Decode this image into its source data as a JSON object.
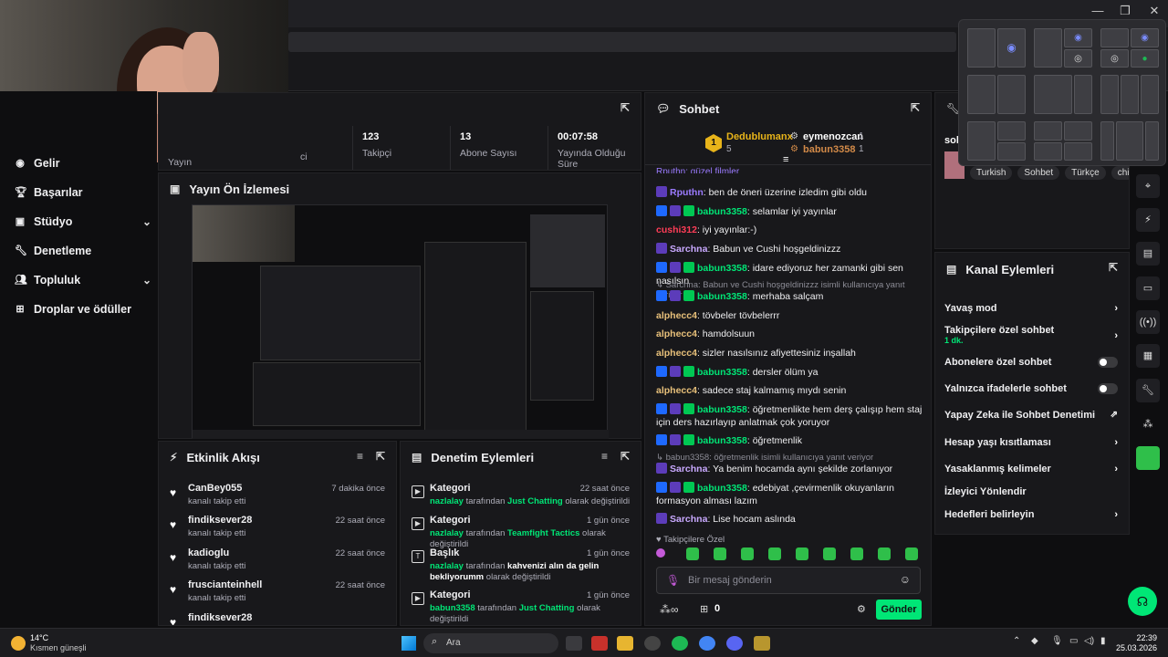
{
  "window": {
    "minimize": "—",
    "maximize": "❐",
    "close": "✕"
  },
  "stats": {
    "followers_value": "123",
    "followers_label": "Takipçi",
    "subs_value": "13",
    "subs_label": "Abone Sayısı",
    "uptime_value": "00:07:58",
    "uptime_label": "Yayında Olduğu Süre",
    "partial_label_1": "Yayın",
    "partial_label_2": "ci"
  },
  "sidebar": {
    "items": [
      {
        "label": "Gelir"
      },
      {
        "label": "Başarılar"
      },
      {
        "label": "Stüdyo"
      },
      {
        "label": "Denetleme"
      },
      {
        "label": "Topluluk"
      },
      {
        "label": "Droplar ve ödüller"
      }
    ]
  },
  "preview": {
    "title": "Yayın Ön İzlemesi"
  },
  "activity": {
    "title": "Etkinlik Akışı",
    "items": [
      {
        "name": "CanBey055",
        "sub": "kanalı takip etti",
        "time": "7 dakika önce"
      },
      {
        "name": "findiksever28",
        "sub": "kanalı takip etti",
        "time": "22 saat önce"
      },
      {
        "name": "kadioglu",
        "sub": "kanalı takip etti",
        "time": "22 saat önce"
      },
      {
        "name": "fruscianteinhell",
        "sub": "kanalı takip etti",
        "time": "22 saat önce"
      },
      {
        "name": "findiksever28",
        "sub": "",
        "time": ""
      }
    ]
  },
  "modlog": {
    "title": "Denetim Eylemleri",
    "items": [
      {
        "title": "Kategori",
        "user": "nazlalay",
        "mid": "tarafından",
        "value": "Just Chatting",
        "end": "olarak değiştirildi",
        "time": "22 saat önce"
      },
      {
        "title": "Kategori",
        "user": "nazlalay",
        "mid": "tarafından",
        "value": "Teamfight Tactics",
        "end": "olarak değiştirildi",
        "time": "1 gün önce"
      },
      {
        "title": "Başlık",
        "user": "nazlalay",
        "mid": "tarafından",
        "value": "kahvenizi alın da gelin bekliyorumm",
        "end": "olarak değiştirildi",
        "time": "1 gün önce"
      },
      {
        "title": "Kategori",
        "user": "babun3358",
        "mid": "tarafından",
        "value": "Just Chatting",
        "end": "olarak değiştirildi",
        "time": "1 gün önce"
      }
    ]
  },
  "chat": {
    "title": "Sohbet",
    "leader1": "Dedublumanx",
    "leader1_count": "5",
    "leader1_rank": "1",
    "leader2": "eymenozcan",
    "leader2_count": "1",
    "leader3": "babun3358",
    "leader3_count": "1",
    "partial_top": "Rputhn: güzel filmler",
    "messages": [
      {
        "user": "Rputhn",
        "color": "#9b7bff",
        "text": "ben de öneri üzerine izledim gibi oldu",
        "badges": [
          "star"
        ]
      },
      {
        "user": "babun3358",
        "color": "#00e676",
        "text": "selamlar iyi yayınlar",
        "badges": [
          "blue",
          "star",
          "green"
        ]
      },
      {
        "user": "cushi312",
        "color": "#ff3d57",
        "text": "iyi yayınlar:-)",
        "badges": []
      },
      {
        "user": "Sarchna",
        "color": "#c9a9ff",
        "text": "Babun ve Cushi hoşgeldinizzz",
        "badges": [
          "star"
        ]
      },
      {
        "user": "babun3358",
        "color": "#00e676",
        "text": "idare ediyoruz her zamanki gibi sen nasılsın",
        "badges": [
          "blue",
          "star",
          "green"
        ]
      }
    ],
    "reply1": "↳ Sarchna: Babun ve Cushi hoşgeldinizzz isimli kullanıcıya yanıt veriyor",
    "messages2": [
      {
        "user": "babun3358",
        "color": "#00e676",
        "text": "merhaba salçam",
        "badges": [
          "blue",
          "star",
          "green"
        ]
      },
      {
        "user": "alphecc4",
        "color": "#e8c07a",
        "text": "tövbeler tövbelerrr",
        "badges": []
      },
      {
        "user": "alphecc4",
        "color": "#e8c07a",
        "text": "hamdolsuun",
        "badges": []
      },
      {
        "user": "alphecc4",
        "color": "#e8c07a",
        "text": "sizler nasılsınız afiyettesiniz inşallah",
        "badges": []
      },
      {
        "user": "babun3358",
        "color": "#00e676",
        "text": "dersler ölüm ya",
        "badges": [
          "blue",
          "star",
          "green"
        ]
      },
      {
        "user": "alphecc4",
        "color": "#e8c07a",
        "text": "sadece staj kalmamış mıydı senin",
        "badges": []
      },
      {
        "user": "babun3358",
        "color": "#00e676",
        "text": "öğretmenlikte hem derş çalışıp hem staj için ders hazırlayıp anlatmak çok yoruyor",
        "badges": [
          "blue",
          "star",
          "green"
        ]
      },
      {
        "user": "babun3358",
        "color": "#00e676",
        "text": "öğretmenlik",
        "badges": [
          "blue",
          "star",
          "green"
        ]
      }
    ],
    "reply2": "↳ babun3358: öğretmenlik isimli kullanıcıya yanıt veriyor",
    "messages3": [
      {
        "user": "Sarchna",
        "color": "#c9a9ff",
        "text": "Ya benim hocamda aynı şekilde zorlanıyor",
        "badges": [
          "star"
        ]
      },
      {
        "user": "babun3358",
        "color": "#00e676",
        "text": "edebiyat ,çevirmenlik okuyanların formasyon alması lazım",
        "badges": [
          "blue",
          "star",
          "green"
        ]
      },
      {
        "user": "Sarchna",
        "color": "#c9a9ff",
        "text": "Lise hocam aslında",
        "badges": [
          "star"
        ]
      }
    ],
    "followers_only": "♥ Takipçilere Özel",
    "input_placeholder": "Bir mesaj gönderin",
    "points": "0",
    "send_label": "Gönder"
  },
  "about": {
    "partial_title": "soh",
    "tags": [
      "Turkish",
      "Sohbet",
      "Türkçe",
      "chi"
    ]
  },
  "channel_actions": {
    "title": "Kanal Eylemleri",
    "items": [
      {
        "label": "Yavaş mod",
        "control": "chevron"
      },
      {
        "label": "Takipçilere özel sohbet",
        "sub": "1 dk.",
        "control": "chevron"
      },
      {
        "label": "Abonelere özel sohbet",
        "control": "toggle"
      },
      {
        "label": "Yalnızca ifadelerle sohbet",
        "control": "toggle"
      },
      {
        "label": "Yapay Zeka ile Sohbet Denetimi",
        "control": "external"
      },
      {
        "label": "Hesap yaşı kısıtlaması",
        "control": "chevron"
      },
      {
        "label": "Yasaklanmış kelimeler",
        "control": "chevron"
      },
      {
        "label": "İzleyici Yönlendir",
        "control": "none"
      },
      {
        "label": "Hedefleri belirleyin",
        "control": "chevron"
      }
    ]
  },
  "taskbar": {
    "temp": "14°C",
    "weather": "Kısmen güneşli",
    "search": "Ara",
    "time": "22:39",
    "date": "25.03.2026"
  },
  "colors": {
    "accent_green": "#00e676",
    "send_bg": "#00e676",
    "bg": "#0e0e10",
    "panel": "#18181b"
  }
}
